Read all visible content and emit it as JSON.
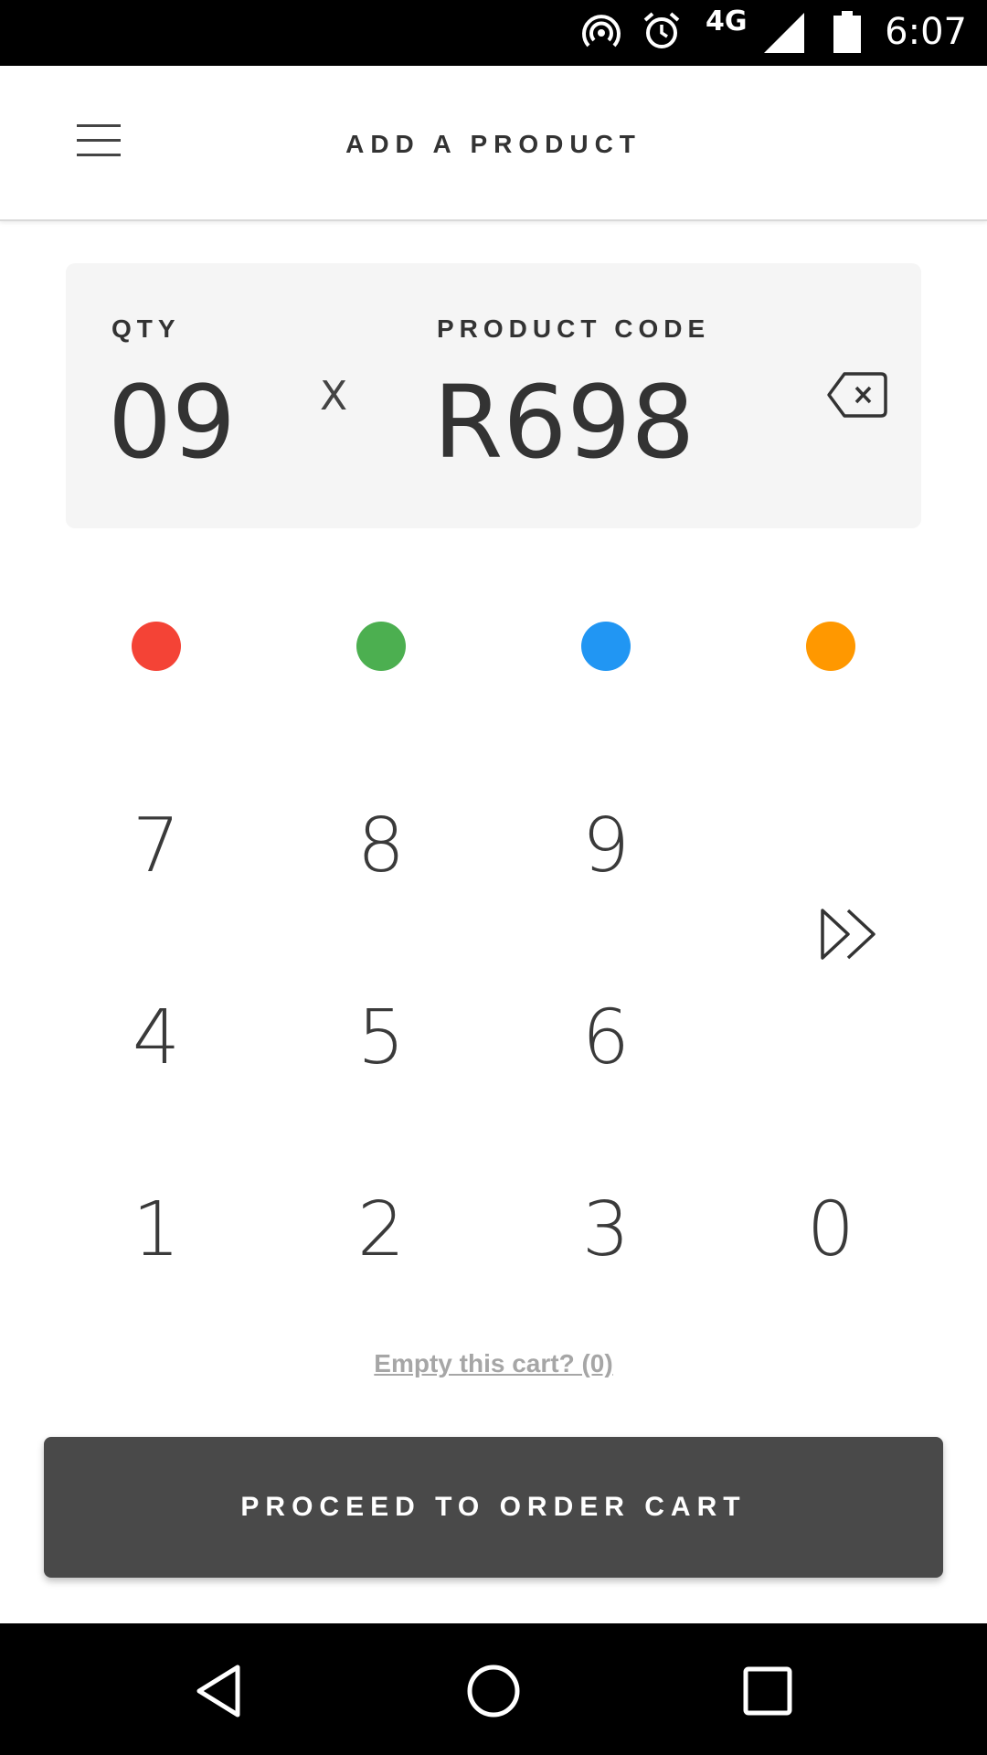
{
  "status_bar": {
    "network": "4G",
    "time": "6:07",
    "icons": [
      "hotspot-icon",
      "alarm-icon",
      "signal-icon",
      "battery-icon"
    ]
  },
  "app_bar": {
    "title": "ADD A PRODUCT",
    "menu_icon": "hamburger-menu-icon"
  },
  "entry": {
    "qty_label": "QTY",
    "qty_value": "09",
    "multiply": "X",
    "code_label": "PRODUCT CODE",
    "code_value": "R698",
    "backspace_icon": "backspace-icon"
  },
  "colors": {
    "red": "#f44336",
    "green": "#4caf50",
    "blue": "#2196f3",
    "orange": "#ff9800"
  },
  "keypad": {
    "rows": [
      [
        "7",
        "8",
        "9"
      ],
      [
        "4",
        "5",
        "6"
      ],
      [
        "1",
        "2",
        "3",
        "0"
      ]
    ],
    "skip_icon": "fast-forward-icon"
  },
  "empty_cart": "Empty this cart? (0)",
  "proceed_button": "PROCEED TO ORDER CART",
  "nav_bar": {
    "icons": [
      "back-icon",
      "home-icon",
      "recents-icon"
    ]
  }
}
